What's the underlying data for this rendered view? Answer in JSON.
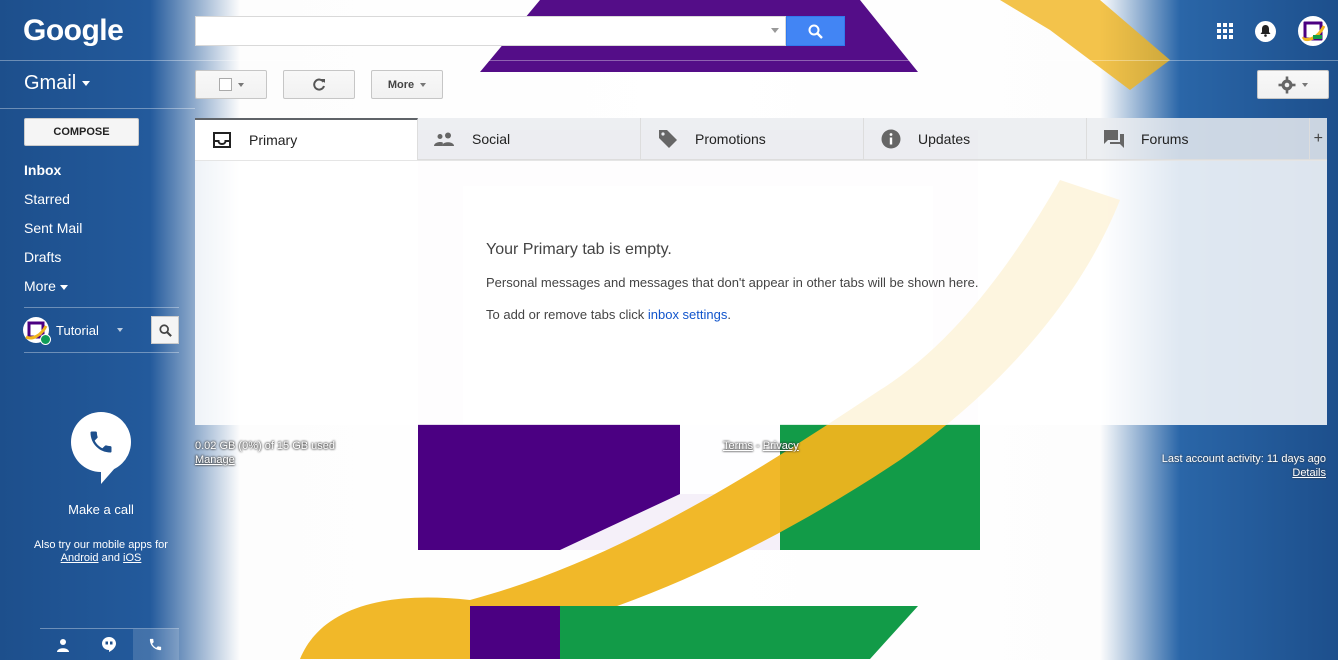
{
  "header": {
    "logo_text": "Google",
    "search": {
      "value": "",
      "placeholder": ""
    },
    "icons": [
      "apps-grid-icon",
      "notifications-bell-icon",
      "account-avatar"
    ]
  },
  "app": {
    "name": "Gmail"
  },
  "toolbar": {
    "select_label": "",
    "refresh_label": "",
    "more_label": "More",
    "settings_label": ""
  },
  "sidebar": {
    "compose_label": "COMPOSE",
    "items": [
      {
        "label": "Inbox",
        "active": true
      },
      {
        "label": "Starred",
        "active": false
      },
      {
        "label": "Sent Mail",
        "active": false
      },
      {
        "label": "Drafts",
        "active": false
      },
      {
        "label": "More",
        "active": false
      }
    ],
    "hangouts": {
      "name": "Tutorial"
    },
    "call": {
      "label": "Make a call",
      "note_prefix": "Also try our mobile apps for",
      "android": "Android",
      "and": "and",
      "ios": "iOS"
    }
  },
  "tabs": [
    {
      "label": "Primary",
      "icon": "inbox-icon",
      "active": true
    },
    {
      "label": "Social",
      "icon": "people-icon",
      "active": false
    },
    {
      "label": "Promotions",
      "icon": "tag-icon",
      "active": false
    },
    {
      "label": "Updates",
      "icon": "info-icon",
      "active": false
    },
    {
      "label": "Forums",
      "icon": "forum-icon",
      "active": false
    }
  ],
  "tab_add_label": "+",
  "empty_state": {
    "title": "Your Primary tab is empty.",
    "description": "Personal messages and messages that don't appear in other tabs will be shown here.",
    "hint_prefix": "To add or remove tabs click",
    "hint_link": "inbox settings",
    "hint_suffix": "."
  },
  "footer": {
    "storage": "0.02 GB (0%) of 15 GB used",
    "manage": "Manage",
    "terms": "Terms",
    "separator": "-",
    "privacy": "Privacy",
    "activity": "Last account activity: 11 days ago",
    "details": "Details"
  },
  "colors": {
    "brand_blue": "#1d4f8c",
    "search_button": "#4285f4",
    "link": "#1155cc",
    "theme_purple": "#4b0082",
    "theme_gold": "#f0b41e",
    "theme_green": "#129b48"
  }
}
